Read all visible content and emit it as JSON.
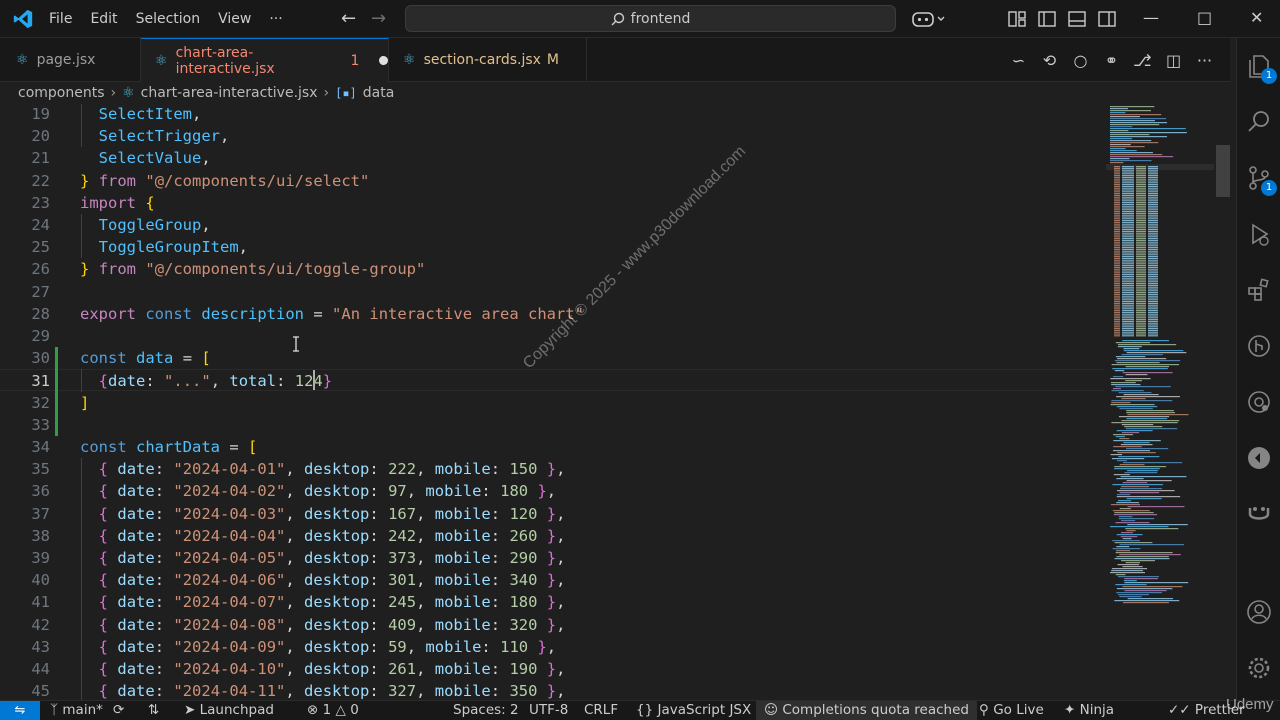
{
  "titlebar": {
    "menu": [
      "File",
      "Edit",
      "Selection",
      "View",
      "···"
    ],
    "search": "frontend"
  },
  "tabs": [
    {
      "label": "page.jsx",
      "suffix": ""
    },
    {
      "label": "chart-area-interactive.jsx",
      "suffix": "1"
    },
    {
      "label": "section-cards.jsx",
      "suffix": "M"
    }
  ],
  "breadcrumb": {
    "folder": "components",
    "file": "chart-area-interactive.jsx",
    "symbol": "data"
  },
  "editor": {
    "current_line": 31,
    "lines": [
      {
        "n": 19,
        "text": "  SelectItem,"
      },
      {
        "n": 20,
        "text": "  SelectTrigger,"
      },
      {
        "n": 21,
        "text": "  SelectValue,"
      },
      {
        "n": 22,
        "text": "} from \"@/components/ui/select\""
      },
      {
        "n": 23,
        "text": "import {"
      },
      {
        "n": 24,
        "text": "  ToggleGroup,"
      },
      {
        "n": 25,
        "text": "  ToggleGroupItem,"
      },
      {
        "n": 26,
        "text": "} from \"@/components/ui/toggle-group\""
      },
      {
        "n": 27,
        "text": ""
      },
      {
        "n": 28,
        "text": "export const description = \"An interactive area chart\""
      },
      {
        "n": 29,
        "text": ""
      },
      {
        "n": 30,
        "text": "const data = ["
      },
      {
        "n": 31,
        "text": "  {date: \"...\", total: 124}"
      },
      {
        "n": 32,
        "text": "]"
      },
      {
        "n": 33,
        "text": ""
      },
      {
        "n": 34,
        "text": "const chartData = ["
      },
      {
        "n": 35,
        "text": "  { date: \"2024-04-01\", desktop: 222, mobile: 150 },"
      },
      {
        "n": 36,
        "text": "  { date: \"2024-04-02\", desktop: 97, mobile: 180 },"
      },
      {
        "n": 37,
        "text": "  { date: \"2024-04-03\", desktop: 167, mobile: 120 },"
      },
      {
        "n": 38,
        "text": "  { date: \"2024-04-04\", desktop: 242, mobile: 260 },"
      },
      {
        "n": 39,
        "text": "  { date: \"2024-04-05\", desktop: 373, mobile: 290 },"
      },
      {
        "n": 40,
        "text": "  { date: \"2024-04-06\", desktop: 301, mobile: 340 },"
      },
      {
        "n": 41,
        "text": "  { date: \"2024-04-07\", desktop: 245, mobile: 180 },"
      },
      {
        "n": 42,
        "text": "  { date: \"2024-04-08\", desktop: 409, mobile: 320 },"
      },
      {
        "n": 43,
        "text": "  { date: \"2024-04-09\", desktop: 59, mobile: 110 },"
      },
      {
        "n": 44,
        "text": "  { date: \"2024-04-10\", desktop: 261, mobile: 190 },"
      },
      {
        "n": 45,
        "text": "  { date: \"2024-04-11\", desktop: 327, mobile: 350 },"
      }
    ]
  },
  "activity_badges": {
    "explorer": "1",
    "source_control": "1"
  },
  "statusbar": {
    "branch": "main*",
    "launchpad": "Launchpad",
    "errors": "1",
    "warnings": "0",
    "spaces": "Spaces: 2",
    "encoding": "UTF-8",
    "eol": "CRLF",
    "language": "JavaScript JSX",
    "completions": "Completions quota reached",
    "golive": "Go Live",
    "ninja": "Ninja",
    "prettier": "Prettier"
  },
  "watermark": "Copyright © 2025 - www.p30download.com",
  "udemy": "Udemy",
  "colors": {
    "accent": "#0078d4",
    "tab_active_text": "#f48771",
    "modified_bar": "#2ea043"
  }
}
